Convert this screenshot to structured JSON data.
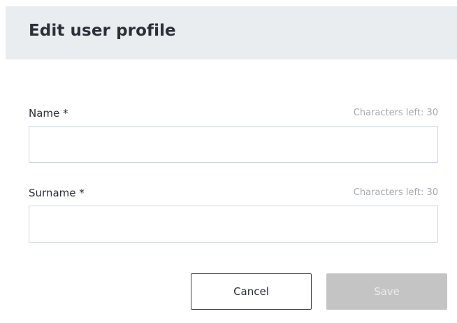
{
  "dialog": {
    "title": "Edit user profile"
  },
  "form": {
    "name": {
      "label": "Name *",
      "counter": "Characters left: 30",
      "value": "",
      "placeholder": ""
    },
    "surname": {
      "label": "Surname *",
      "counter": "Characters left: 30",
      "value": "",
      "placeholder": ""
    }
  },
  "actions": {
    "cancel_label": "Cancel",
    "save_label": "Save",
    "save_disabled": true
  },
  "colors": {
    "header_bg": "#e9edf0",
    "cancel_border": "#2c3e5c",
    "save_disabled_bg": "#c4c4c4",
    "input_border": "#c9d6df",
    "counter_text": "#a4a9ae"
  }
}
